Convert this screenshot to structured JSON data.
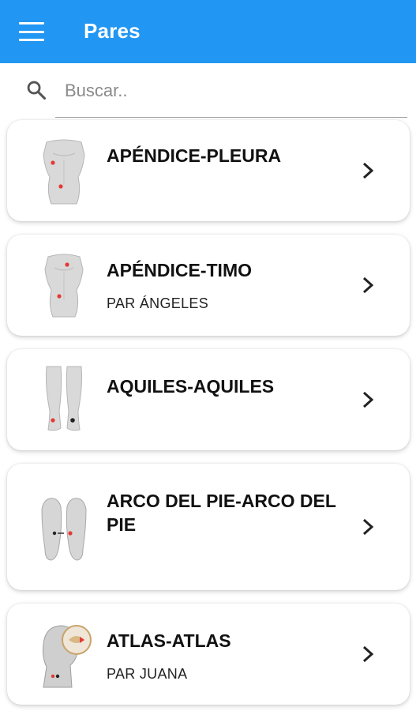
{
  "appbar": {
    "title": "Pares",
    "color": "#2196f3"
  },
  "search": {
    "placeholder": "Buscar..",
    "value": ""
  },
  "items": [
    {
      "name": "APÉNDICE-PLEURA",
      "subtitle": "",
      "thumb": "torso-front-icon"
    },
    {
      "name": "APÉNDICE-TIMO",
      "subtitle": "PAR ÁNGELES",
      "thumb": "torso-front-icon"
    },
    {
      "name": "AQUILES-AQUILES",
      "subtitle": "",
      "thumb": "lower-legs-back-icon"
    },
    {
      "name": "ARCO DEL PIE-ARCO DEL PIE",
      "subtitle": "",
      "thumb": "foot-soles-icon"
    },
    {
      "name": "ATLAS-ATLAS",
      "subtitle": "PAR JUANA",
      "thumb": "head-neck-side-icon"
    }
  ]
}
